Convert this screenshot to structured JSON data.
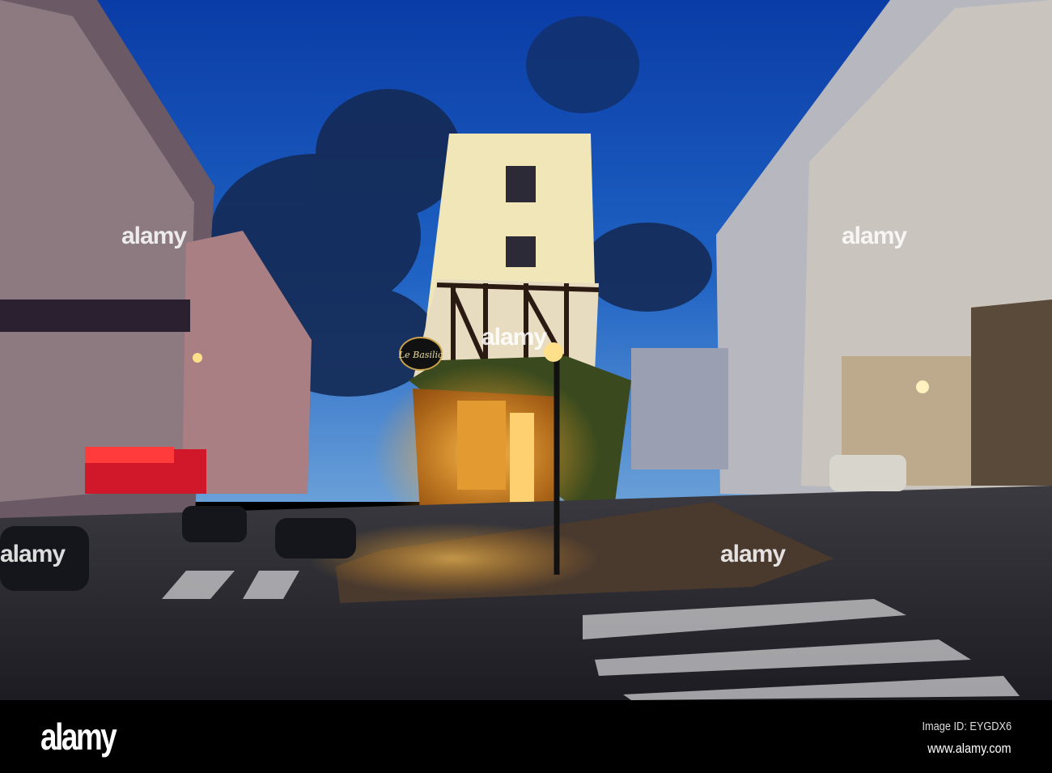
{
  "watermark": {
    "brand": "alamy"
  },
  "sign": {
    "restaurant_name": "Le Basilic"
  },
  "footer": {
    "logo": "alamy",
    "image_id": "Image ID: EYGDX6",
    "website": "www.alamy.com"
  },
  "colors": {
    "sky_top": "#0b3fa8",
    "sky_horizon": "#3f7fd0",
    "lamp_glow": "#ffb02e",
    "awning_red": "#d0182a"
  }
}
